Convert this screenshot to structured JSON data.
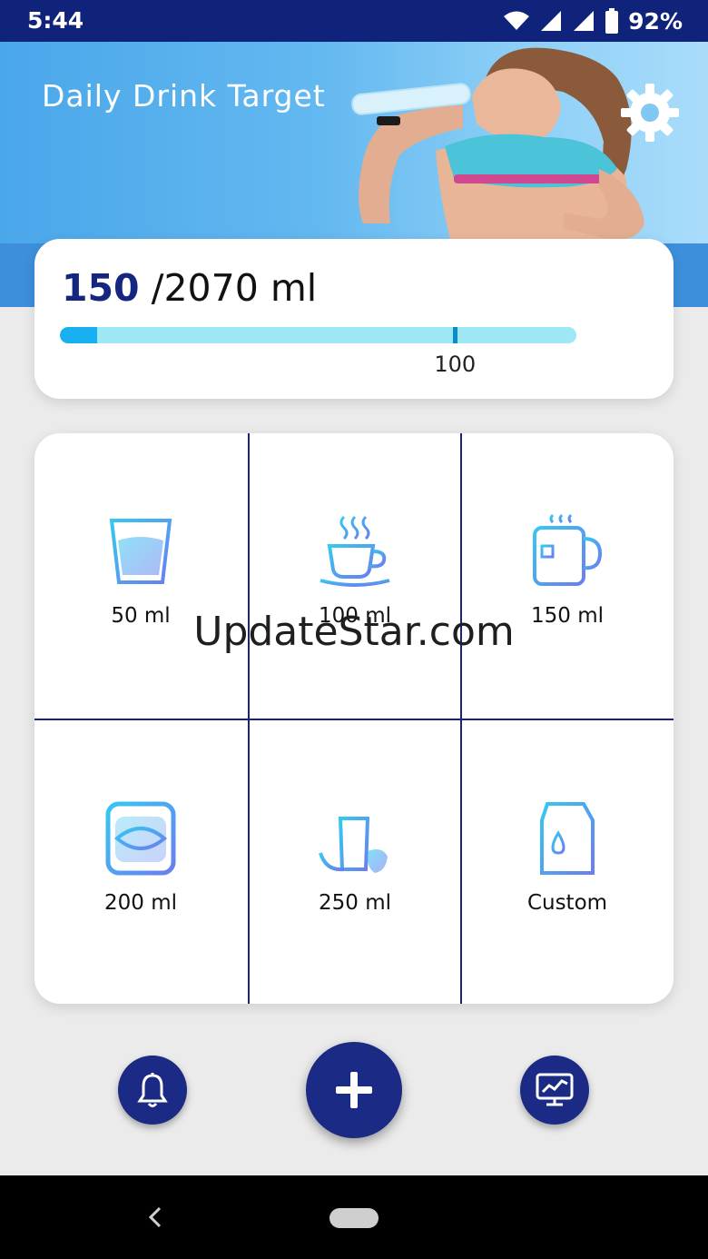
{
  "status_bar": {
    "time": "5:44",
    "battery_text": "92%",
    "icons": [
      "wifi-icon",
      "signal-icon",
      "signal-icon",
      "battery-icon"
    ]
  },
  "header": {
    "title": "Daily Drink Target",
    "settings_icon": "gear-icon"
  },
  "progress": {
    "current": "150",
    "separator_total": "/2070 ml",
    "fraction": 0.072,
    "marker_value": "100",
    "marker_fraction": 0.765
  },
  "drinks": [
    {
      "label": "50 ml",
      "icon": "glass-icon"
    },
    {
      "label": "100 ml",
      "icon": "coffee-cup-icon"
    },
    {
      "label": "150 ml",
      "icon": "tea-mug-icon"
    },
    {
      "label": "200 ml",
      "icon": "bottle-icon"
    },
    {
      "label": "250 ml",
      "icon": "smoothie-icon"
    },
    {
      "label": "Custom",
      "icon": "milk-carton-icon"
    }
  ],
  "watermark": "UpdateStar.com",
  "actions": {
    "reminder_icon": "bell-icon",
    "add_icon": "plus-icon",
    "stats_icon": "chart-monitor-icon"
  },
  "colors": {
    "primary": "#1a2a85",
    "progress_track": "#9ee8f5",
    "progress_fill": "#18b0f0",
    "icon_gradient_start": "#35c8f0",
    "icon_gradient_end": "#6a7ef0"
  }
}
